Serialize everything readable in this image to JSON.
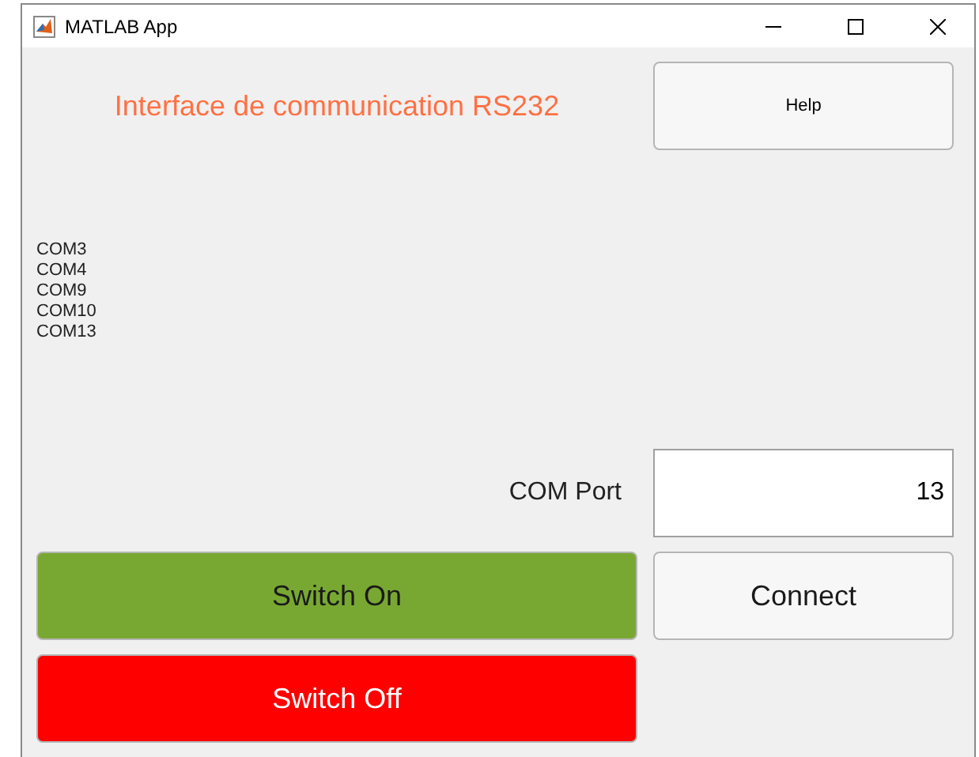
{
  "window": {
    "title": "MATLAB App"
  },
  "heading": "Interface de communication RS232",
  "help_button": "Help",
  "ports": [
    "COM3",
    "COM4",
    "COM9",
    "COM10",
    "COM13"
  ],
  "com_port": {
    "label": "COM Port",
    "value": "13"
  },
  "switch_buttons": [
    {
      "label": "Switch On",
      "kind": "on"
    },
    {
      "label": "Switch Off",
      "kind": "off"
    }
  ],
  "connect_button": "Connect"
}
